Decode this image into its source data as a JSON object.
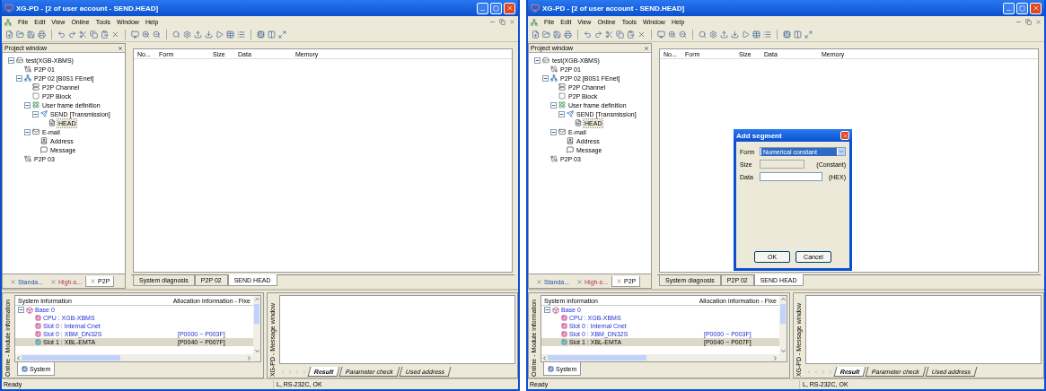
{
  "windows": [
    {
      "title": "XG-PD - [2 of user account - SEND.HEAD]",
      "menu": [
        "File",
        "Edit",
        "View",
        "Online",
        "Tools",
        "Window",
        "Help"
      ],
      "project_window": {
        "title": "Project window",
        "tree": [
          {
            "label": "test(XGB-XBMS)",
            "kind": "plc",
            "expanded": true,
            "selected": false,
            "children": [
              {
                "label": "P2P 01",
                "kind": "link",
                "selected": false
              },
              {
                "label": "P2P 02 [B0S1 FEnet]",
                "kind": "network",
                "expanded": true,
                "selected": false,
                "children": [
                  {
                    "label": "P2P Channel",
                    "kind": "channel",
                    "selected": false
                  },
                  {
                    "label": "P2P Block",
                    "kind": "block",
                    "selected": false
                  },
                  {
                    "label": "User frame definition",
                    "kind": "frame",
                    "expanded": true,
                    "selected": false,
                    "children": [
                      {
                        "label": "SEND [Transmission]",
                        "kind": "send",
                        "expanded": true,
                        "selected": false,
                        "children": [
                          {
                            "label": "HEAD",
                            "kind": "segment",
                            "selected": true
                          }
                        ]
                      }
                    ]
                  },
                  {
                    "label": "E-mail",
                    "kind": "email",
                    "expanded": true,
                    "selected": false,
                    "children": [
                      {
                        "label": "Address",
                        "kind": "address",
                        "selected": false
                      },
                      {
                        "label": "Message",
                        "kind": "message",
                        "selected": false
                      }
                    ]
                  }
                ]
              },
              {
                "label": "P2P 03",
                "kind": "link",
                "selected": false
              }
            ]
          }
        ],
        "tabs": [
          {
            "label": "Standa...",
            "selected": false
          },
          {
            "label": "High-s...",
            "selected": false
          },
          {
            "label": "P2P",
            "selected": true
          }
        ]
      },
      "editor": {
        "columns": [
          "No...",
          "Form",
          "Size",
          "Data",
          "Memory"
        ],
        "tabs": [
          {
            "label": "System diagnosis",
            "selected": false
          },
          {
            "label": "P2P 02",
            "selected": false
          },
          {
            "label": "SEND HEAD",
            "selected": true
          }
        ]
      },
      "module_info": {
        "side_label": "Online - Module information",
        "columns": [
          "System information",
          "Allocation information - Fixe"
        ],
        "rows": [
          {
            "label": "Base 0",
            "expanded": true,
            "selected": false,
            "children": [
              {
                "label": "CPU : XGB-XBMS",
                "selected": false
              },
              {
                "label": "Slot 0 : Internal Cnet",
                "selected": false
              },
              {
                "label": "Slot 0 : XBM_DN32S",
                "allocation": "[P0000 ~ P003F]",
                "selected": false
              },
              {
                "label": "Slot 1 : XBL-EMTA",
                "allocation": "[P0040 ~ P007F]",
                "selected": true
              }
            ]
          }
        ],
        "tabs": [
          {
            "label": "System",
            "selected": true
          }
        ]
      },
      "message_window": {
        "side_label": "XG-PD - Message window",
        "tabs": [
          {
            "label": "Result",
            "selected": true
          },
          {
            "label": "Parameter check",
            "selected": false
          },
          {
            "label": "Used address",
            "selected": false
          }
        ]
      },
      "status_bar": {
        "left": "Ready",
        "right": "L, RS-232C, OK"
      }
    },
    {
      "title": "XG-PD - [2 of user account - SEND.HEAD]",
      "menu": [
        "File",
        "Edit",
        "View",
        "Online",
        "Tools",
        "Window",
        "Help"
      ],
      "project_window": {
        "title": "Project window",
        "tree": [
          {
            "label": "test(XGB-XBMS)",
            "kind": "plc",
            "expanded": true,
            "selected": false,
            "children": [
              {
                "label": "P2P 01",
                "kind": "link",
                "selected": false
              },
              {
                "label": "P2P 02 [B0S1 FEnet]",
                "kind": "network",
                "expanded": true,
                "selected": false,
                "children": [
                  {
                    "label": "P2P Channel",
                    "kind": "channel",
                    "selected": false
                  },
                  {
                    "label": "P2P Block",
                    "kind": "block",
                    "selected": false
                  },
                  {
                    "label": "User frame definition",
                    "kind": "frame",
                    "expanded": true,
                    "selected": false,
                    "children": [
                      {
                        "label": "SEND [Transmission]",
                        "kind": "send",
                        "expanded": true,
                        "selected": false,
                        "children": [
                          {
                            "label": "HEAD",
                            "kind": "segment",
                            "selected": true
                          }
                        ]
                      }
                    ]
                  },
                  {
                    "label": "E-mail",
                    "kind": "email",
                    "expanded": true,
                    "selected": false,
                    "children": [
                      {
                        "label": "Address",
                        "kind": "address",
                        "selected": false
                      },
                      {
                        "label": "Message",
                        "kind": "message",
                        "selected": false
                      }
                    ]
                  }
                ]
              },
              {
                "label": "P2P 03",
                "kind": "link",
                "selected": false
              }
            ]
          }
        ],
        "tabs": [
          {
            "label": "Standa...",
            "selected": false
          },
          {
            "label": "High-s...",
            "selected": false
          },
          {
            "label": "P2P",
            "selected": true
          }
        ]
      },
      "editor": {
        "columns": [
          "No...",
          "Form",
          "Size",
          "Data",
          "Memory"
        ],
        "tabs": [
          {
            "label": "System diagnosis",
            "selected": false
          },
          {
            "label": "P2P 02",
            "selected": false
          },
          {
            "label": "SEND HEAD",
            "selected": true
          }
        ]
      },
      "dialog": {
        "title": "Add segment",
        "fields": [
          {
            "label": "Form",
            "kind": "combo",
            "value": "Numerical constant"
          },
          {
            "label": "Size",
            "kind": "disabled",
            "suffix": "(Constant)"
          },
          {
            "label": "Data",
            "kind": "text",
            "suffix": "(HEX)"
          }
        ],
        "buttons": [
          "OK",
          "Cancel"
        ]
      },
      "module_info": {
        "side_label": "Online - Module information",
        "columns": [
          "System information",
          "Allocation information - Fixe"
        ],
        "rows": [
          {
            "label": "Base 0",
            "expanded": true,
            "selected": false,
            "children": [
              {
                "label": "CPU : XGB-XBMS",
                "selected": false
              },
              {
                "label": "Slot 0 : Internal Cnet",
                "selected": false
              },
              {
                "label": "Slot 0 : XBM_DN32S",
                "allocation": "[P0000 ~ P003F]",
                "selected": false
              },
              {
                "label": "Slot 1 : XBL-EMTA",
                "allocation": "[P0040 ~ P007F]",
                "selected": true
              }
            ]
          }
        ],
        "tabs": [
          {
            "label": "System",
            "selected": true
          }
        ]
      },
      "message_window": {
        "side_label": "XG-PD - Message window",
        "tabs": [
          {
            "label": "Result",
            "selected": true
          },
          {
            "label": "Parameter check",
            "selected": false
          },
          {
            "label": "Used address",
            "selected": false
          }
        ]
      },
      "status_bar": {
        "left": "Ready",
        "right": "L, RS-232C, OK"
      }
    }
  ]
}
